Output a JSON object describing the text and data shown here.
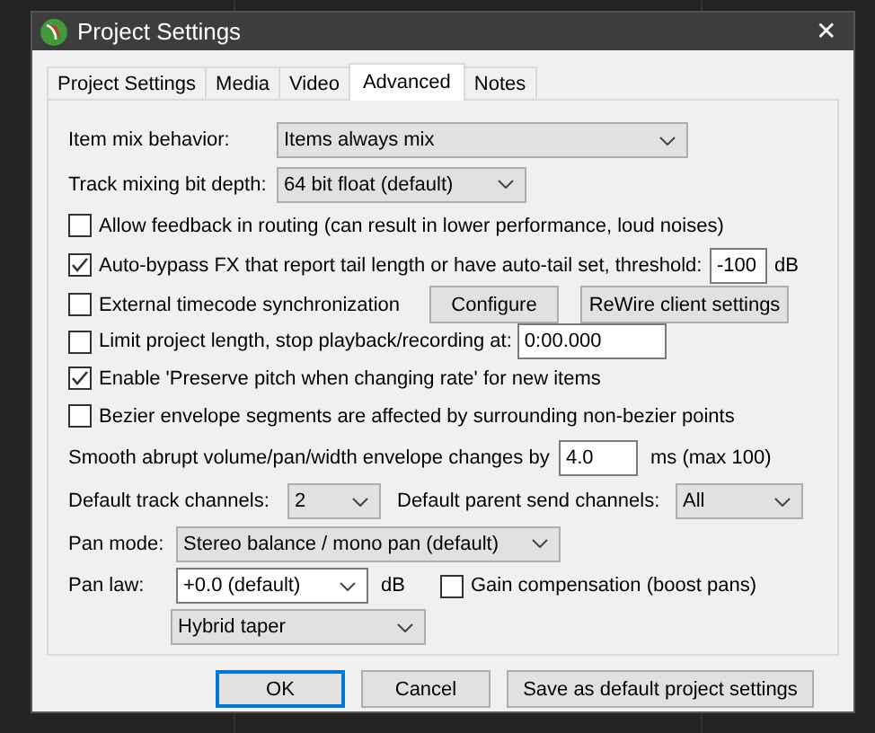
{
  "window": {
    "title": "Project Settings",
    "close": "✕"
  },
  "tabs": [
    {
      "label": "Project Settings",
      "selected": false
    },
    {
      "label": "Media",
      "selected": false
    },
    {
      "label": "Video",
      "selected": false
    },
    {
      "label": "Advanced",
      "selected": true
    },
    {
      "label": "Notes",
      "selected": false
    }
  ],
  "rows": [
    [
      {
        "kind": "label",
        "text": "Item mix behavior:"
      },
      {
        "kind": "combo",
        "value": "Items always mix"
      }
    ],
    [
      {
        "kind": "label",
        "text": "Track mixing bit depth:"
      },
      {
        "kind": "combo",
        "value": "64 bit float (default)"
      }
    ],
    [
      {
        "kind": "check",
        "text": "Allow feedback in routing (can result in lower performance, loud noises)",
        "checked": false
      }
    ],
    [
      {
        "kind": "check",
        "text": "Auto-bypass FX that report tail length or have auto-tail set, threshold:",
        "checked": true
      },
      {
        "kind": "field",
        "value": "-100"
      },
      {
        "kind": "label",
        "text": "dB"
      }
    ],
    [
      {
        "kind": "check",
        "text": "External timecode synchronization",
        "checked": false
      },
      {
        "kind": "button",
        "text": "Configure"
      },
      {
        "kind": "button",
        "text": "ReWire client settings"
      }
    ],
    [
      {
        "kind": "check",
        "text": "Limit project length, stop playback/recording at:",
        "checked": false
      },
      {
        "kind": "field",
        "value": "0:00.000"
      }
    ],
    [
      {
        "kind": "check",
        "text": "Enable 'Preserve pitch when changing rate' for new items",
        "checked": true
      }
    ],
    [
      {
        "kind": "check",
        "text": "Bezier envelope segments are affected by surrounding non-bezier points",
        "checked": false
      }
    ],
    [
      {
        "kind": "label",
        "text": "Smooth abrupt volume/pan/width envelope changes by"
      },
      {
        "kind": "field",
        "value": "4.0"
      },
      {
        "kind": "label",
        "text": "ms (max 100)"
      }
    ],
    [
      {
        "kind": "label",
        "text": "Default track channels:"
      },
      {
        "kind": "combo",
        "value": "2"
      },
      {
        "kind": "label",
        "text": "Default parent send channels:"
      },
      {
        "kind": "combo",
        "value": "All"
      }
    ],
    [
      {
        "kind": "label",
        "text": "Pan mode:"
      },
      {
        "kind": "combo",
        "value": "Stereo balance / mono pan (default)"
      }
    ],
    [
      {
        "kind": "label",
        "text": "Pan law:"
      },
      {
        "kind": "editable_combo",
        "value": "+0.0 (default)"
      },
      {
        "kind": "label",
        "text": "dB"
      },
      {
        "kind": "check",
        "text": "Gain compensation (boost pans)",
        "checked": false
      }
    ],
    [
      {
        "kind": "combo",
        "value": "Hybrid taper"
      }
    ]
  ],
  "buttons": [
    {
      "label": "OK",
      "focused": true
    },
    {
      "label": "Cancel",
      "focused": false
    },
    {
      "label": "Save as default project settings",
      "focused": false
    }
  ]
}
